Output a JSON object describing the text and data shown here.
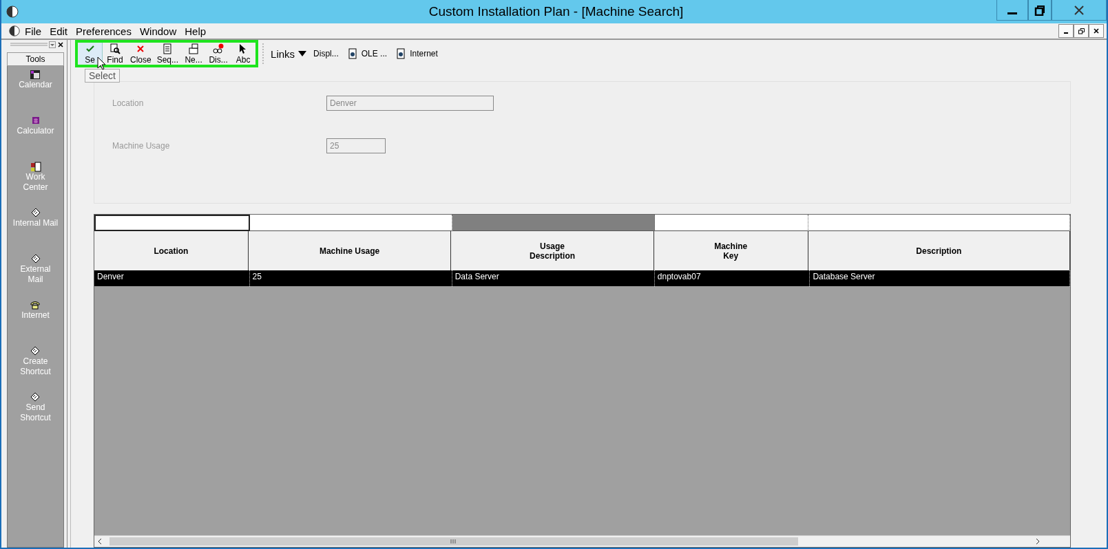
{
  "window": {
    "title": "Custom Installation Plan - [Machine Search]"
  },
  "menu": [
    "File",
    "Edit",
    "Preferences",
    "Window",
    "Help"
  ],
  "sidebar": {
    "title": "Tools",
    "items": [
      {
        "label": "Calendar",
        "kind": "calendar"
      },
      {
        "label": "Calculator",
        "kind": "calculator"
      },
      {
        "label": "Work\nCenter",
        "kind": "workcenter"
      },
      {
        "label": "Internal Mail",
        "kind": "mail"
      },
      {
        "label": "External\nMail",
        "kind": "mail"
      },
      {
        "label": "Internet",
        "kind": "phone"
      },
      {
        "label": "Create\nShortcut",
        "kind": "mail"
      },
      {
        "label": "Send\nShortcut",
        "kind": "mail"
      }
    ]
  },
  "toolbar": {
    "buttons": [
      {
        "label": "Se",
        "kind": "check",
        "selected": true
      },
      {
        "label": "Find",
        "kind": "find",
        "selected": false
      },
      {
        "label": "Close",
        "kind": "close",
        "selected": false
      },
      {
        "label": "Seq...",
        "kind": "sequence",
        "selected": false
      },
      {
        "label": "Ne...",
        "kind": "new",
        "selected": false
      },
      {
        "label": "Dis...",
        "kind": "display",
        "selected": false
      },
      {
        "label": "Abc",
        "kind": "pointer",
        "selected": false
      }
    ],
    "tooltip": "Select",
    "links": {
      "label": "Links",
      "items": [
        {
          "label": "Displ...",
          "kind": "plain"
        },
        {
          "label": "OLE ...",
          "kind": "doc"
        },
        {
          "label": "Internet",
          "kind": "doc"
        }
      ]
    }
  },
  "form": {
    "fields": [
      {
        "label": "Location",
        "value": "Denver"
      },
      {
        "label": "Machine Usage",
        "value": "25"
      }
    ]
  },
  "table": {
    "columns": [
      {
        "header": "Location",
        "filter_selected": false
      },
      {
        "header": "Machine Usage",
        "filter_selected": false
      },
      {
        "header": "Usage\nDescription",
        "filter_selected": true
      },
      {
        "header": "Machine\nKey",
        "filter_selected": false
      },
      {
        "header": "Description",
        "filter_selected": false
      }
    ],
    "rows": [
      {
        "cells": [
          "Denver",
          "25",
          "Data Server",
          "dnptovab07",
          "Database Server"
        ],
        "selected": true
      }
    ]
  }
}
